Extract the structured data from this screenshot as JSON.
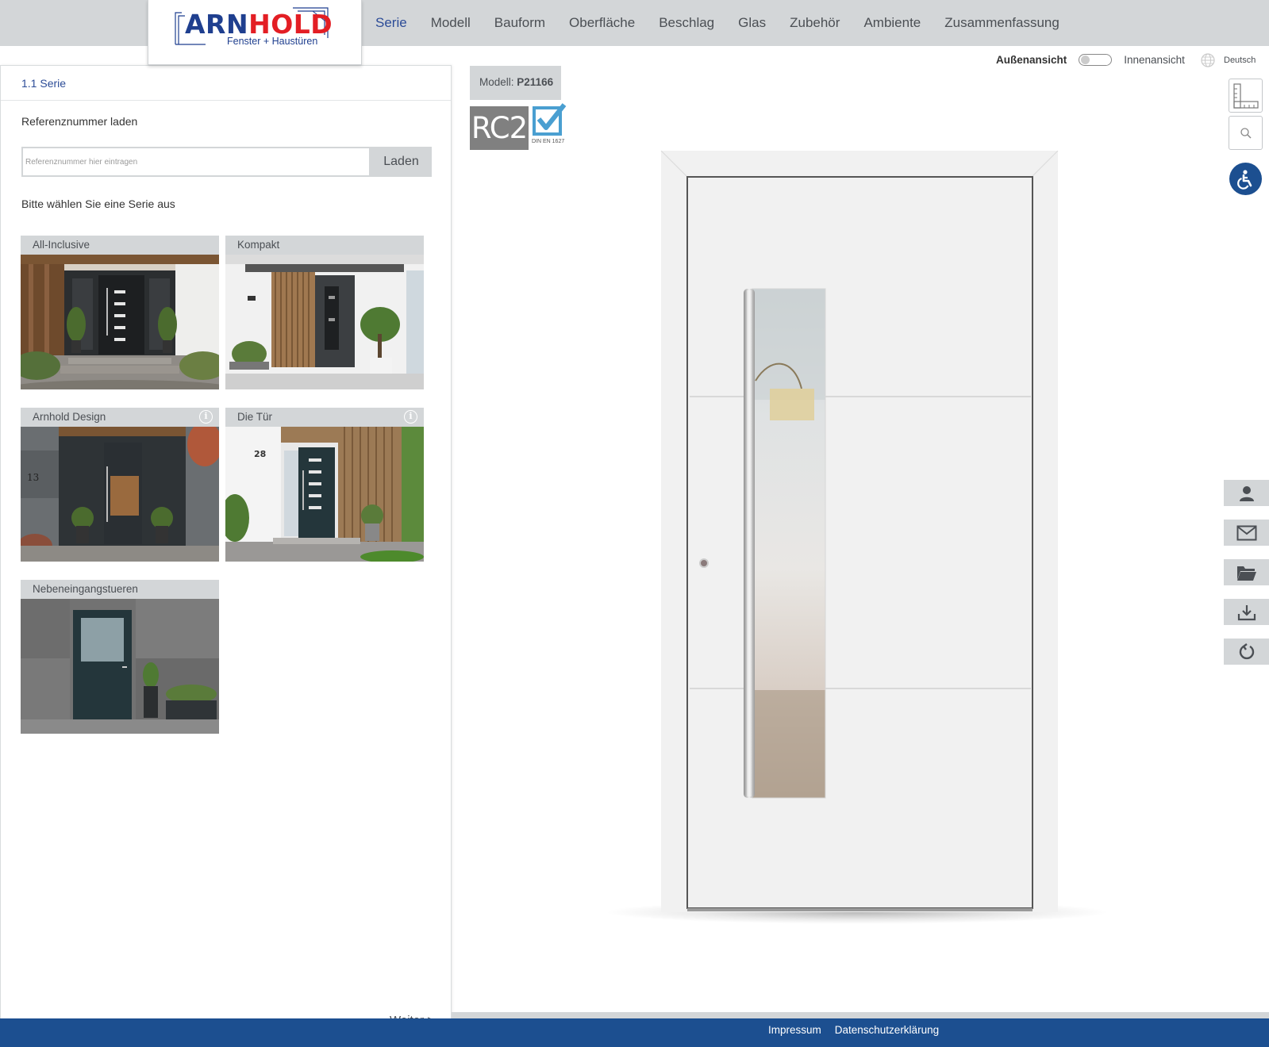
{
  "header": {
    "logo_name": "ARNHOLD",
    "logo_sub": "Fenster + Haustüren",
    "nav": [
      "Serie",
      "Modell",
      "Bauform",
      "Oberfläche",
      "Beschlag",
      "Glas",
      "Zubehör",
      "Ambiente",
      "Zusammenfassung"
    ],
    "active_nav": "Serie"
  },
  "left": {
    "section_title": "1.1 Serie",
    "ref_label": "Referenznummer laden",
    "ref_placeholder": "Referenznummer hier eintragen",
    "ref_button": "Laden",
    "choose_label": "Bitte wählen Sie eine Serie aus",
    "series": [
      {
        "name": "All-Inclusive",
        "info": false
      },
      {
        "name": "Kompakt",
        "info": false
      },
      {
        "name": "Arnhold Design",
        "info": true
      },
      {
        "name": "Die Tür",
        "info": true
      },
      {
        "name": "Nebeneingangstueren",
        "info": false
      }
    ],
    "info_icon": "i",
    "card_house_number_1": "13",
    "card_house_number_2": "28",
    "next": "Weiter  >"
  },
  "model": {
    "label": "Modell:",
    "code": "P21166",
    "rc2": "RC2",
    "din": "DIN EN 1627"
  },
  "view": {
    "outside": "Außenansicht",
    "inside": "Innenansicht",
    "language": "Deutsch"
  },
  "footer": {
    "impressum": "Impressum",
    "privacy": "Datenschutzerklärung"
  },
  "colors": {
    "brand_blue": "#1c4f90",
    "nav_active": "#2c4c97",
    "panel_grey": "#d3d6d8",
    "logo_red": "#e31e24"
  },
  "icons": [
    "ruler-icon",
    "zoom-icon",
    "accessibility-icon",
    "user-icon",
    "mail-icon",
    "folder-icon",
    "download-icon",
    "reset-icon",
    "globe-icon",
    "info-icon",
    "rc2-check-icon"
  ]
}
